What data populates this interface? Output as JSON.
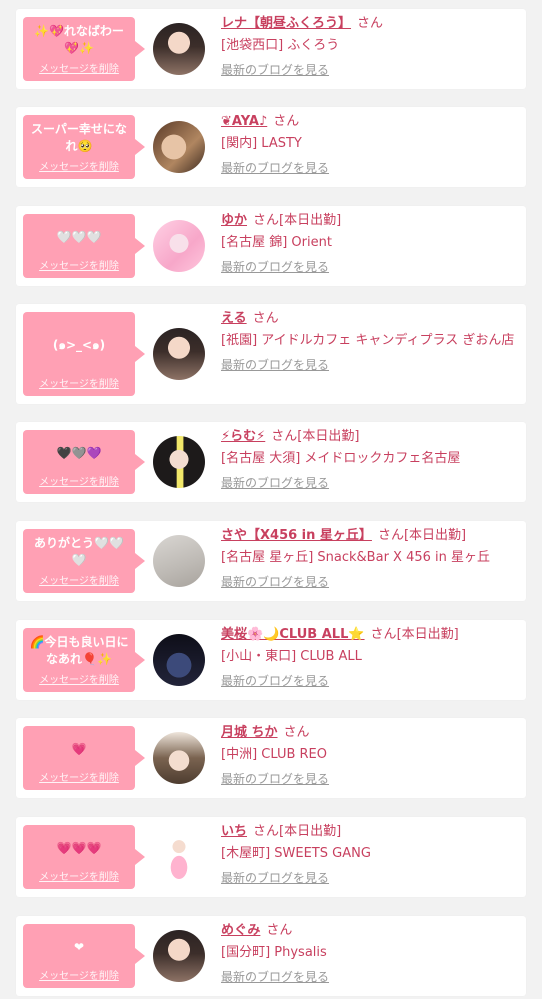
{
  "delete_label": "メッセージを削除",
  "san_label": "さん",
  "blog_label": "最新のブログを見る",
  "colors": {
    "bubble": "#ffa0b4",
    "name": "#c8405f",
    "link": "#999999"
  },
  "cards": [
    {
      "message": "✨💖れなばわー💖✨",
      "name": "レナ【朝昼ふくろう】",
      "status": "",
      "shop": "[池袋西口] ふくろう",
      "avatar": "avatar-photo-girl"
    },
    {
      "message": "スーパー幸せになれ🥺",
      "name": "❦AYA♪",
      "status": "",
      "shop": "[関内] LASTY",
      "avatar": "avatar-photo-closeup"
    },
    {
      "message": "🤍🤍🤍",
      "name": "ゆか",
      "status": "[本日出勤]",
      "shop": "[名古屋 錦] Orient",
      "avatar": "avatar-photo-pink"
    },
    {
      "message": "(๑>_<๑)",
      "name": "える",
      "status": "",
      "shop": "[祇園] アイドルカフェ キャンディプラス ぎおん店",
      "avatar": "avatar-photo-girl"
    },
    {
      "message": "🖤🩶💜",
      "name": "⚡らむ⚡",
      "status": "[本日出勤]",
      "shop": "[名古屋 大須] メイドロックカフェ名古屋",
      "avatar": "avatar-photo-peace"
    },
    {
      "message": "ありがとう🤍🤍🤍",
      "name": "さや【X456 in 星ヶ丘】",
      "status": "[本日出勤]",
      "shop": "[名古屋 星ヶ丘] Snack&Bar X 456 in 星ヶ丘",
      "avatar": "avatar-photo-wall"
    },
    {
      "message": "🌈今日も良い日になあれ🎈✨",
      "name": "美桜🌸🌙CLUB ALL⭐",
      "status": "[本日出勤]",
      "shop": "[小山・東口] CLUB ALL",
      "avatar": "avatar-photo-logo"
    },
    {
      "message": "💗",
      "name": "月城 ちか",
      "status": "",
      "shop": "[中洲] CLUB REO",
      "avatar": "avatar-photo-cap"
    },
    {
      "message": "💗💗💗",
      "name": "いち",
      "status": "[本日出勤]",
      "shop": "[木屋町] SWEETS GANG",
      "avatar": "avatar-photo-idol"
    },
    {
      "message": "❤",
      "name": "めぐみ",
      "status": "",
      "shop": "[国分町] Physalis",
      "avatar": "avatar-photo-girl"
    }
  ]
}
